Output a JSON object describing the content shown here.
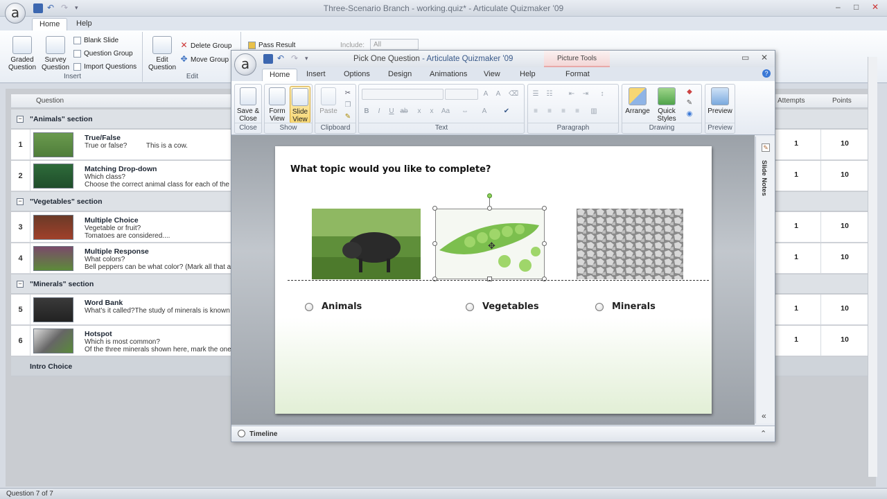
{
  "app": {
    "window_title": "Three-Scenario Branch - working.quiz* - Articulate Quizmaker '09",
    "logo_text": "a",
    "tabs": [
      "Home",
      "Help"
    ],
    "ribbon": {
      "insert": {
        "label": "Insert",
        "graded": "Graded\nQuestion",
        "survey": "Survey\nQuestion",
        "blank": "Blank Slide",
        "qgroup": "Question Group",
        "import": "Import Questions"
      },
      "edit": {
        "label": "Edit",
        "edit_q": "Edit\nQuestion",
        "delete_group": "Delete Group",
        "move_group": "Move Group"
      },
      "pass_result": "Pass Result",
      "include_label": "Include:",
      "include_value": "All"
    },
    "columns": {
      "question": "Question",
      "attempts": "Attempts",
      "points": "Points"
    },
    "sections": [
      {
        "label": "\"Animals\" section"
      },
      {
        "label": "\"Vegetables\" section"
      },
      {
        "label": "\"Minerals\" section"
      },
      {
        "label": "Intro Choice"
      }
    ],
    "rows": [
      {
        "num": "1",
        "type": "True/False",
        "line2": "True or false?          This is a cow.",
        "line3": "",
        "attempts": "1",
        "points": "10"
      },
      {
        "num": "2",
        "type": "Matching Drop-down",
        "line2": "Which class?",
        "line3": "Choose the correct animal class for each of the an",
        "attempts": "1",
        "points": "10"
      },
      {
        "num": "3",
        "type": "Multiple Choice",
        "line2": "Vegetable or fruit?",
        "line3": "Tomatoes are considered....",
        "attempts": "1",
        "points": "10"
      },
      {
        "num": "4",
        "type": "Multiple Response",
        "line2": "What colors?",
        "line3": "Bell peppers can be what color? (Mark all that appl",
        "attempts": "1",
        "points": "10"
      },
      {
        "num": "5",
        "type": "Word Bank",
        "line2": "What's it called?The study of minerals is known as:",
        "line3": "",
        "attempts": "1",
        "points": "10"
      },
      {
        "num": "6",
        "type": "Hotspot",
        "line2": "Which is most common?",
        "line3": "Of the three minerals shown here, mark the one th",
        "attempts": "1",
        "points": "10"
      }
    ],
    "status": "Question 7 of 7"
  },
  "dialog": {
    "title": "Pick One Question",
    "title_app": " - Articulate Quizmaker '09",
    "picture_tools": "Picture Tools",
    "tabs": [
      "Home",
      "Insert",
      "Options",
      "Design",
      "Animations",
      "View",
      "Help",
      "Format"
    ],
    "groups": {
      "close": {
        "label": "Close",
        "btn": "Save &\nClose"
      },
      "show": {
        "label": "Show",
        "form": "Form\nView",
        "slide": "Slide\nView"
      },
      "clipboard": {
        "label": "Clipboard",
        "paste": "Paste"
      },
      "text": {
        "label": "Text"
      },
      "paragraph": {
        "label": "Paragraph"
      },
      "drawing": {
        "label": "Drawing",
        "arrange": "Arrange",
        "quick": "Quick\nStyles"
      },
      "preview": {
        "label": "Preview",
        "btn": "Preview"
      }
    },
    "slide": {
      "question": "What topic would you like to complete?",
      "options": [
        "Animals",
        "Vegetables",
        "Minerals"
      ]
    },
    "notes_label": "Slide Notes",
    "timeline": "Timeline"
  }
}
